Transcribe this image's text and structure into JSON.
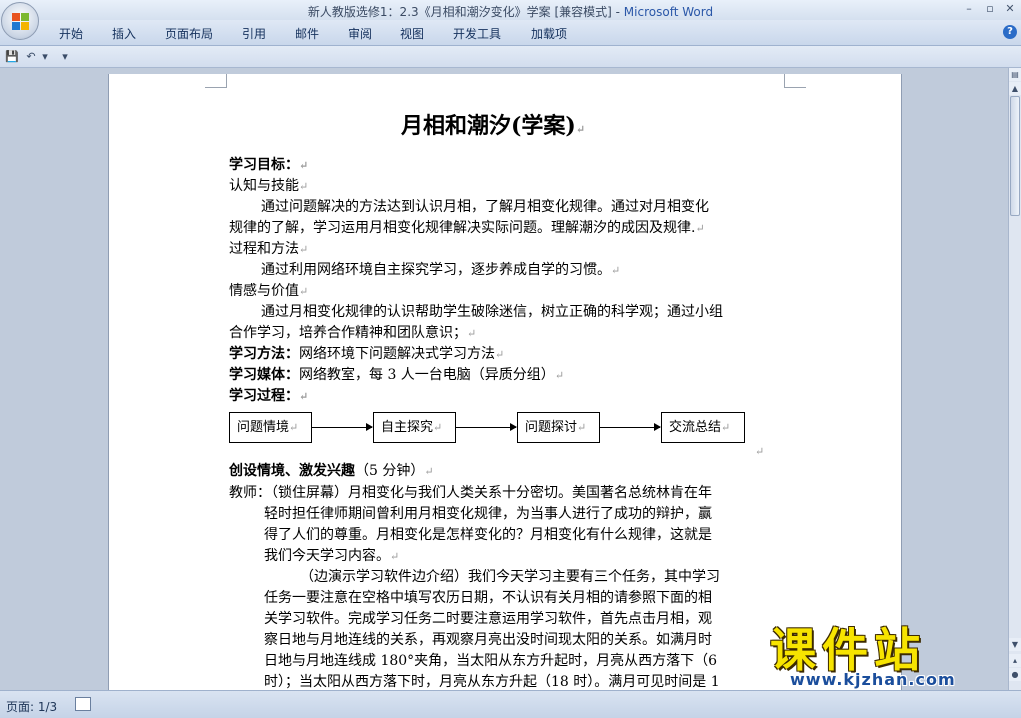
{
  "window": {
    "doc_title": "新人教版选修1：2.3《月相和潮汐变化》学案 [兼容模式]",
    "separator": " - ",
    "app_name": "Microsoft Word",
    "controls": [
      "–",
      "▫",
      "✕"
    ]
  },
  "ribbon": {
    "tabs": [
      "开始",
      "插入",
      "页面布局",
      "引用",
      "邮件",
      "审阅",
      "视图",
      "开发工具",
      "加载项"
    ],
    "help": "?"
  },
  "qat": {
    "save": "💾",
    "undo": "↶",
    "undo_drop": "▾",
    "customize": "▾"
  },
  "document": {
    "title": "月相和潮汐(学案)",
    "para_mark": "↵",
    "lines": {
      "goals_label": "学习目标：",
      "cat1": "认知与技能",
      "p1a": "通过问题解决的方法达到认识月相，了解月相变化规律。通过对月相变化",
      "p1b": "规律的了解，学习运用月相变化规律解决实际问题。理解潮汐的成因及规律.",
      "cat2": "过程和方法",
      "p2": "通过利用网络环境自主探究学习，逐步养成自学的习惯。",
      "cat3": "情感与价值",
      "p3a": "通过月相变化规律的认识帮助学生破除迷信，树立正确的科学观；通过小组",
      "p3b": "合作学习，培养合作精神和团队意识；",
      "method_label": "学习方法：",
      "method_text": "网络环境下问题解决式学习方法",
      "media_label": "学习媒体：",
      "media_text": "网络教室，每 3 人一台电脑（异质分组）",
      "process_label": "学习过程："
    },
    "flow": [
      "问题情境",
      "自主探究",
      "问题探讨",
      "交流总结"
    ],
    "section_title": "创设情境、激发兴趣",
    "section_time": "（5 分钟）",
    "body": [
      "教师：（锁住屏幕）月相变化与我们人类关系十分密切。美国著名总统林肯在年",
      "轻时担任律师期间曾利用月相变化规律，为当事人进行了成功的辩护，赢",
      "得了人们的尊重。月相变化是怎样变化的？月相变化有什么规律，这就是",
      "我们今天学习内容。",
      "（边演示学习软件边介绍）我们今天学习主要有三个任务，其中学习",
      "任务一要注意在空格中填写农历日期，不认识有关月相的请参照下面的相",
      "关学习软件。完成学习任务二时要注意运用学习软件，首先点击月相，观",
      "察日地与月地连线的关系，再观察月亮出没时间现太阳的关系。如满月时",
      "日地与月地连线成 180°夹角，当太阳从东方升起时，月亮从西方落下（6",
      "时）；当太阳从西方落下时，月亮从东方升起（18 时）。满月可见时间是 1"
    ]
  },
  "status": {
    "page": "页面: 1/3"
  },
  "watermark": {
    "title": "课件站",
    "url": "www.kjzhan.com"
  }
}
